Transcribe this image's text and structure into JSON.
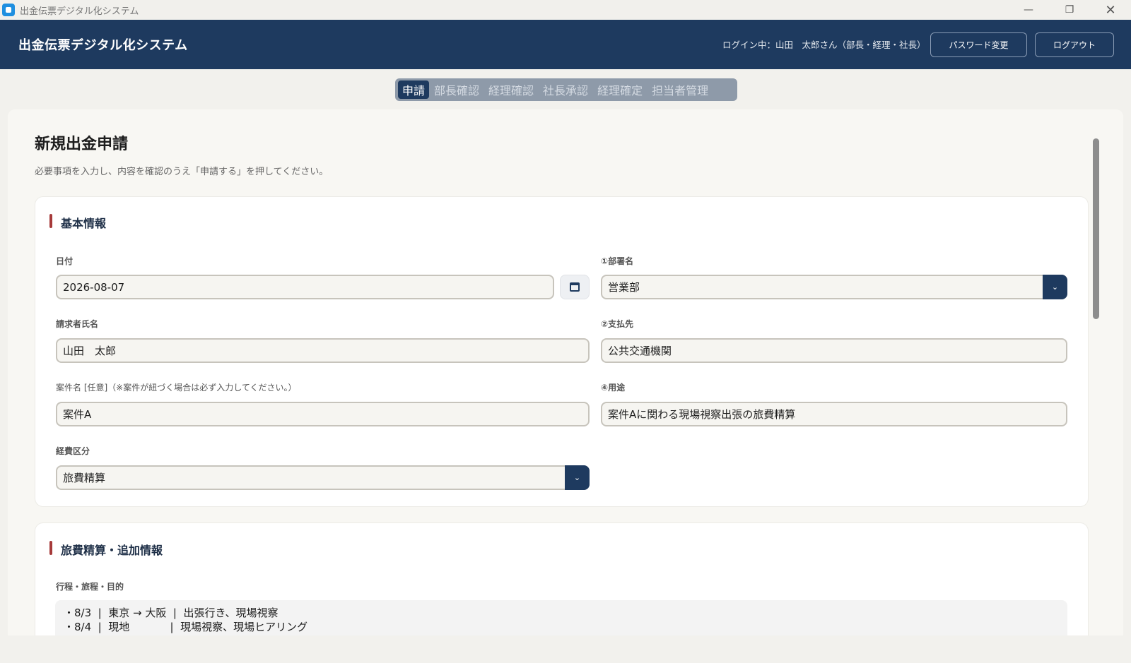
{
  "window": {
    "title": "出金伝票デジタル化システム",
    "min_glyph": "—",
    "max_glyph": "❐",
    "close_glyph": "✕"
  },
  "header": {
    "title": "出金伝票デジタル化システム",
    "login_status": "ログイン中：山田　太郎さん（部長・経理・社長）",
    "password_button": "パスワード変更",
    "logout_button": "ログアウト"
  },
  "tabs": [
    {
      "label": "申請",
      "active": true
    },
    {
      "label": "部長確認",
      "active": false
    },
    {
      "label": "経理確認",
      "active": false
    },
    {
      "label": "社長承認",
      "active": false
    },
    {
      "label": "経理確定",
      "active": false
    },
    {
      "label": "担当者管理",
      "active": false
    }
  ],
  "page": {
    "title": "新規出金申請",
    "description": "必要事項を入力し、内容を確認のうえ「申請する」を押してください。"
  },
  "basic_info": {
    "section_title": "基本情報",
    "date": {
      "label": "日付",
      "value": "2026-08-07"
    },
    "department": {
      "label": "①部署名",
      "value": "営業部"
    },
    "requester": {
      "label": "請求者氏名",
      "value": "山田　太郎"
    },
    "payee": {
      "label": "②支払先",
      "value": "公共交通機関"
    },
    "project": {
      "label": "案件名 [任意]（※案件が紐づく場合は必ず入力してください。）",
      "value": "案件A"
    },
    "purpose": {
      "label": "④用途",
      "value": "案件Aに関わる現場視察出張の旅費精算"
    },
    "expense_type": {
      "label": "経費区分",
      "value": "旅費精算"
    },
    "select_arrow": "⌄"
  },
  "travel_info": {
    "section_title": "旅費精算・追加情報",
    "itinerary": {
      "label": "行程・旅程・目的",
      "value": "・8/3  |  東京 → 大阪  |  出張行き、現場視察\n・8/4  |  現地            |  現場視察、現場ヒアリング"
    }
  },
  "colors": {
    "navy": "#1e3a5f",
    "accent_bar": "#a63a3a",
    "background": "#f2f1ed"
  }
}
